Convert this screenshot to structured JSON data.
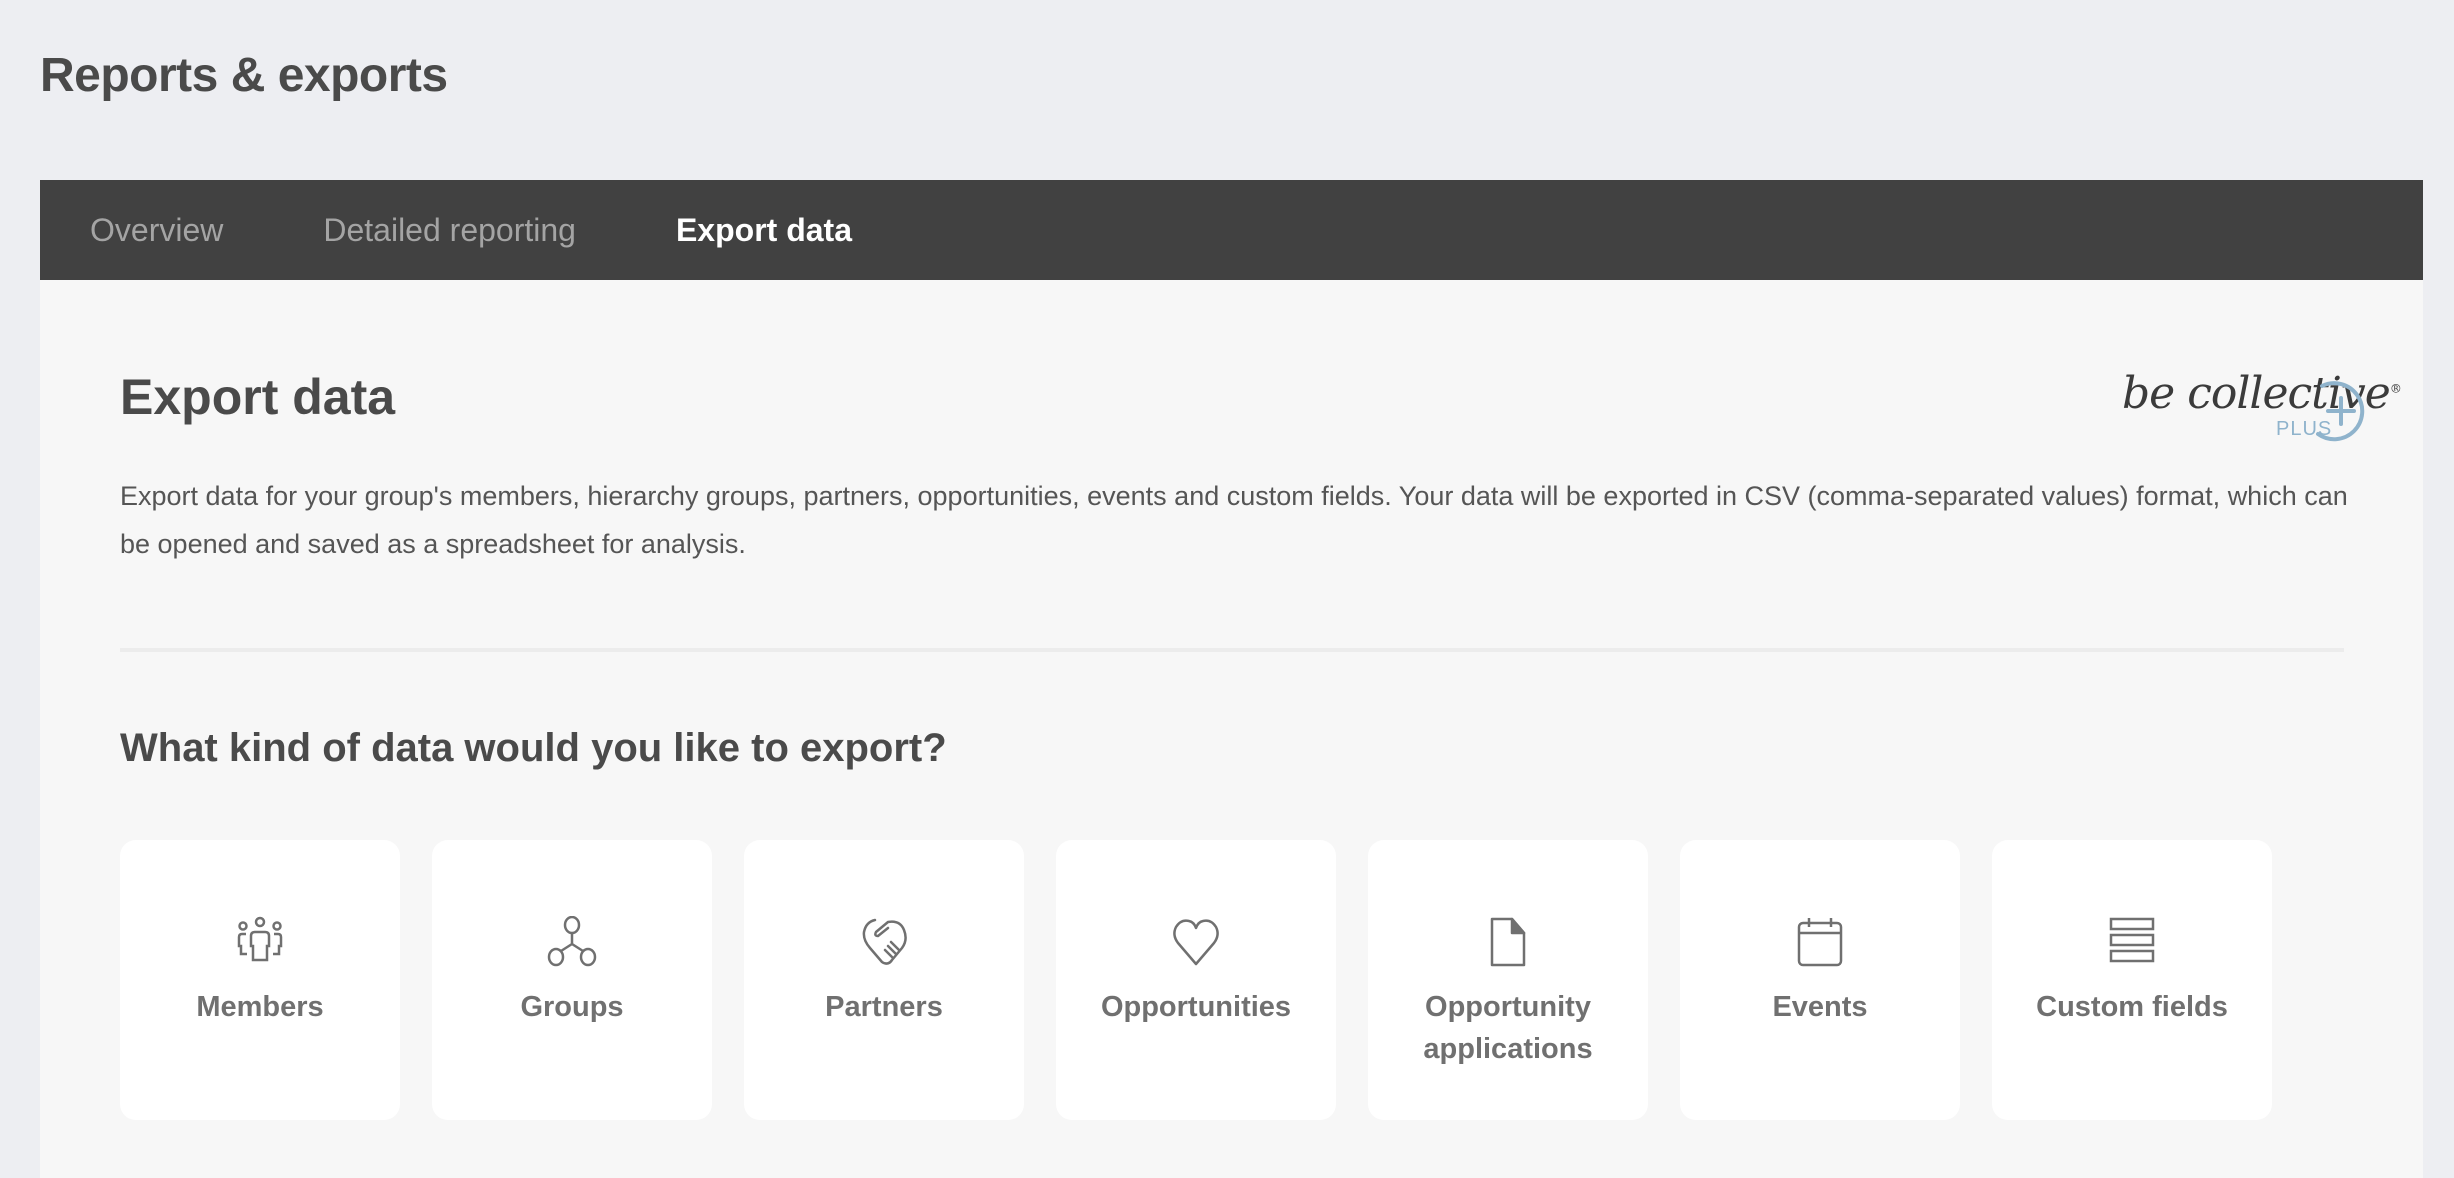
{
  "page": {
    "title": "Reports & exports"
  },
  "tabs": [
    {
      "label": "Overview",
      "active": false
    },
    {
      "label": "Detailed reporting",
      "active": false
    },
    {
      "label": "Export data",
      "active": true
    }
  ],
  "export": {
    "title": "Export data",
    "description": "Export data for your group's members, hierarchy groups, partners, opportunities, events and custom fields. Your data will be exported in CSV (comma-separated values) format, which can be opened and saved as a spreadsheet for analysis.",
    "question": "What kind of data would you like to export?",
    "options": [
      {
        "label": "Members",
        "icon": "members-icon"
      },
      {
        "label": "Groups",
        "icon": "groups-icon"
      },
      {
        "label": "Partners",
        "icon": "handshake-icon"
      },
      {
        "label": "Opportunities",
        "icon": "heart-icon"
      },
      {
        "label": "Opportunity applications",
        "icon": "document-icon"
      },
      {
        "label": "Events",
        "icon": "calendar-icon"
      },
      {
        "label": "Custom fields",
        "icon": "custom-fields-icon"
      }
    ]
  },
  "logo": {
    "brand": "be collective",
    "registered": "®",
    "tier": "PLUS"
  },
  "colors": {
    "background": "#EDEEF2",
    "tabbar": "#414141",
    "panel": "#F7F7F7",
    "logo_accent": "#8FB3CC",
    "icon": "#707070"
  }
}
